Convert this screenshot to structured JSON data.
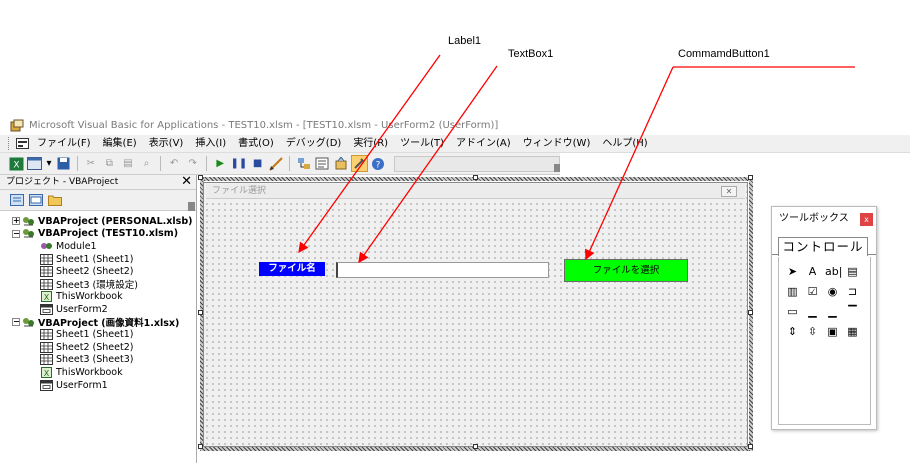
{
  "annotations": {
    "label1": "Label1",
    "textbox1": "TextBox1",
    "button1": "CommamdButton1"
  },
  "colors": {
    "arrow": "#ff0000",
    "label_bg": "#0000ff",
    "button_bg": "#00ff00",
    "toolbox_close": "#e04343"
  },
  "window": {
    "title": "Microsoft Visual Basic for Applications - TEST10.xlsm - [TEST10.xlsm - UserForm2 (UserForm)]",
    "icon": "vba-app-icon"
  },
  "menu": [
    "ファイル(F)",
    "編集(E)",
    "表示(V)",
    "挿入(I)",
    "書式(O)",
    "デバッグ(D)",
    "実行(R)",
    "ツール(T)",
    "アドイン(A)",
    "ウィンドウ(W)",
    "ヘルプ(H)"
  ],
  "toolbar_icons": [
    "view-excel-icon",
    "insert-userform-icon",
    "dropdown-arrow-icon",
    "save-icon",
    "cut-icon",
    "copy-icon",
    "paste-icon",
    "find-icon",
    "undo-icon",
    "redo-icon",
    "run-icon",
    "break-icon",
    "reset-icon",
    "design-mode-icon",
    "project-explorer-icon",
    "properties-icon",
    "object-browser-icon",
    "toolbox-icon",
    "help-icon"
  ],
  "project": {
    "title": "プロジェクト - VBAProject",
    "close": "✕",
    "tree": [
      {
        "label": "VBAProject (PERSONAL.xlsb)",
        "level": 0,
        "bold": true,
        "expander": "+",
        "icon": "vbaproject-icon"
      },
      {
        "label": "VBAProject (TEST10.xlsm)",
        "level": 0,
        "bold": true,
        "expander": "−",
        "icon": "vbaproject-icon"
      },
      {
        "label": "Module1",
        "level": 1,
        "bold": false,
        "icon": "module-icon"
      },
      {
        "label": "Sheet1 (Sheet1)",
        "level": 1,
        "bold": false,
        "icon": "sheet-icon"
      },
      {
        "label": "Sheet2 (Sheet2)",
        "level": 1,
        "bold": false,
        "icon": "sheet-icon"
      },
      {
        "label": "Sheet3 (環境設定)",
        "level": 1,
        "bold": false,
        "icon": "sheet-icon"
      },
      {
        "label": "ThisWorkbook",
        "level": 1,
        "bold": false,
        "icon": "workbook-icon"
      },
      {
        "label": "UserForm2",
        "level": 1,
        "bold": false,
        "icon": "userform-icon"
      },
      {
        "label": "VBAProject (画像資料1.xlsx)",
        "level": 0,
        "bold": true,
        "expander": "−",
        "icon": "vbaproject-icon"
      },
      {
        "label": "Sheet1 (Sheet1)",
        "level": 1,
        "bold": false,
        "icon": "sheet-icon"
      },
      {
        "label": "Sheet2 (Sheet2)",
        "level": 1,
        "bold": false,
        "icon": "sheet-icon"
      },
      {
        "label": "Sheet3 (Sheet3)",
        "level": 1,
        "bold": false,
        "icon": "sheet-icon"
      },
      {
        "label": "ThisWorkbook",
        "level": 1,
        "bold": false,
        "icon": "workbook-icon"
      },
      {
        "label": "UserForm1",
        "level": 1,
        "bold": false,
        "icon": "userform-icon"
      }
    ]
  },
  "form": {
    "caption": "ファイル選択",
    "close": "✕",
    "label": "ファイル名",
    "textbox_value": "",
    "button": "ファイルを選択"
  },
  "toolbox": {
    "title": "ツールボックス",
    "close": "x",
    "tab": "コントロール",
    "controls": [
      {
        "name": "select-objects-icon",
        "glyph": "➤"
      },
      {
        "name": "label-tool-icon",
        "glyph": "A"
      },
      {
        "name": "textbox-tool-icon",
        "glyph": "ab|"
      },
      {
        "name": "combobox-tool-icon",
        "glyph": "▤"
      },
      {
        "name": "listbox-tool-icon",
        "glyph": "▥"
      },
      {
        "name": "checkbox-tool-icon",
        "glyph": "☑"
      },
      {
        "name": "optionbutton-tool-icon",
        "glyph": "◉"
      },
      {
        "name": "togglebutton-tool-icon",
        "glyph": "⊐"
      },
      {
        "name": "frame-tool-icon",
        "glyph": "▭"
      },
      {
        "name": "commandbutton-tool-icon",
        "glyph": "▁"
      },
      {
        "name": "tabstrip-tool-icon",
        "glyph": "▁"
      },
      {
        "name": "multipage-tool-icon",
        "glyph": "▔"
      },
      {
        "name": "scrollbar-tool-icon",
        "glyph": "⇕"
      },
      {
        "name": "spinbutton-tool-icon",
        "glyph": "⇳"
      },
      {
        "name": "image-tool-icon",
        "glyph": "▣"
      },
      {
        "name": "refedit-tool-icon",
        "glyph": "▦"
      }
    ]
  }
}
